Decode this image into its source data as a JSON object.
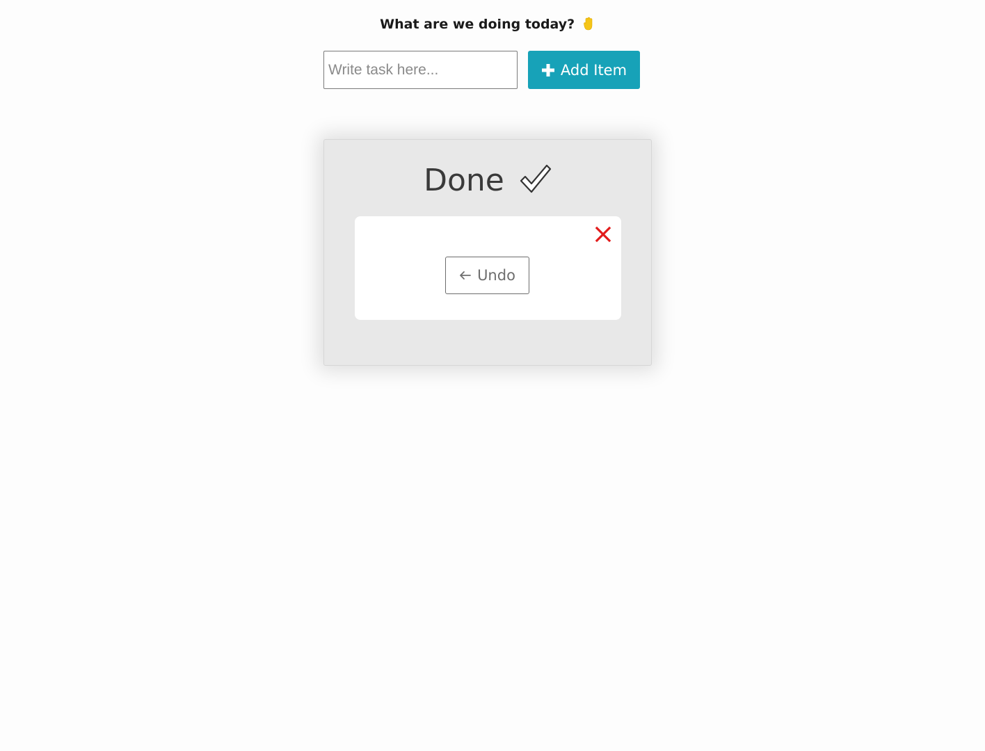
{
  "header": {
    "title": "What are we doing today?",
    "emoji_icon": "raised-hand-icon"
  },
  "task_form": {
    "input_value": "",
    "input_placeholder": "Write task here...",
    "add_button_label": "Add Item",
    "add_button_icon": "plus-icon"
  },
  "done_panel": {
    "title": "Done",
    "title_icon": "check-mark-icon",
    "items": [
      {
        "text": "",
        "delete_icon": "close-icon",
        "undo_label": "Undo",
        "undo_icon": "arrow-left-icon"
      }
    ]
  },
  "colors": {
    "page_background": "#fdfdfd",
    "accent": "#17a2b8",
    "panel_background": "#e8e8e8",
    "card_background": "#ffffff",
    "delete": "#e21b1b",
    "hand_emoji": "#f5c518"
  }
}
